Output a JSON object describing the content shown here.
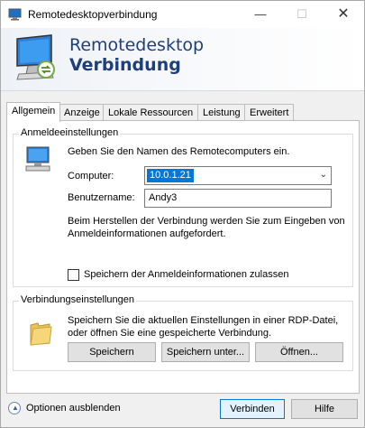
{
  "window": {
    "title": "Remotedesktopverbindung",
    "min_glyph": "—",
    "max_glyph": "☐",
    "close_glyph": "✕"
  },
  "banner": {
    "line1": "Remotedesktop",
    "line2": "Verbindung"
  },
  "tabs": [
    {
      "label": "Allgemein",
      "active": true
    },
    {
      "label": "Anzeige",
      "active": false
    },
    {
      "label": "Lokale Ressourcen",
      "active": false
    },
    {
      "label": "Leistung",
      "active": false
    },
    {
      "label": "Erweitert",
      "active": false
    }
  ],
  "login": {
    "legend": "Anmeldeeinstellungen",
    "description": "Geben Sie den Namen des Remotecomputers ein.",
    "computer_label": "Computer:",
    "computer_value": "10.0.1.21",
    "user_label": "Benutzername:",
    "user_value": "Andy3",
    "info": "Beim Herstellen der Verbindung werden Sie zum Eingeben von Anmeldeinformationen aufgefordert.",
    "save_credentials_label": "Speichern der Anmeldeinformationen zulassen",
    "save_credentials_checked": false
  },
  "connection": {
    "legend": "Verbindungseinstellungen",
    "description": "Speichern Sie die aktuellen Einstellungen in einer RDP-Datei, oder öffnen Sie eine gespeicherte Verbindung.",
    "save_label": "Speichern",
    "save_as_label": "Speichern unter...",
    "open_label": "Öffnen..."
  },
  "footer": {
    "hide_options_label": "Optionen ausblenden",
    "connect_label": "Verbinden",
    "help_label": "Hilfe"
  },
  "colors": {
    "accent": "#0078d7",
    "banner_text": "#1f3f7a"
  }
}
